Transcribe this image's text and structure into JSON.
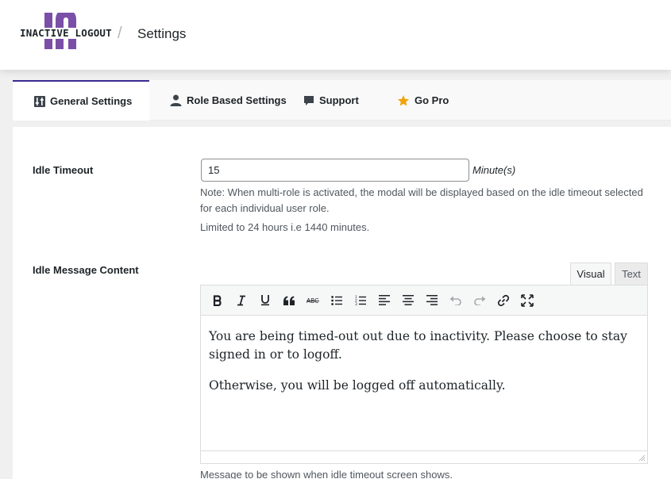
{
  "header": {
    "logo_text": "INACTIVE LOGOUT",
    "separator": "/",
    "title": "Settings",
    "brand_color": "#7b4fa8"
  },
  "tabs": [
    {
      "label": "General Settings",
      "icon": "sliders-icon",
      "active": true
    },
    {
      "label": "Role Based Settings",
      "icon": "user-icon",
      "active": false
    },
    {
      "label": "Support",
      "icon": "speech-bubble-icon",
      "active": false
    },
    {
      "label": "Go Pro",
      "icon": "star-icon",
      "active": false
    }
  ],
  "idle_timeout": {
    "label": "Idle Timeout",
    "value": "15",
    "unit": "Minute(s)",
    "note": "Note: When multi-role is activated, the modal will be displayed based on the idle timeout selected for each individual user role.",
    "limit_note": "Limited to 24 hours i.e 1440 minutes."
  },
  "idle_message": {
    "label": "Idle Message Content",
    "editor_tabs": {
      "visual": "Visual",
      "text": "Text"
    },
    "toolbar": [
      "bold-icon",
      "italic-icon",
      "underline-icon",
      "blockquote-icon",
      "strikethrough-icon",
      "bullet-list-icon",
      "numbered-list-icon",
      "align-left-icon",
      "align-center-icon",
      "align-right-icon",
      "undo-icon",
      "redo-icon",
      "link-icon",
      "fullscreen-icon"
    ],
    "paragraphs": [
      "You are being timed-out out due to inactivity. Please choose to stay signed in or to logoff.",
      "Otherwise, you will be logged off automatically."
    ],
    "helper": "Message to be shown when idle timeout screen shows."
  },
  "colors": {
    "active_tab_border": "#3c2a8f",
    "star": "#f0a30a"
  }
}
